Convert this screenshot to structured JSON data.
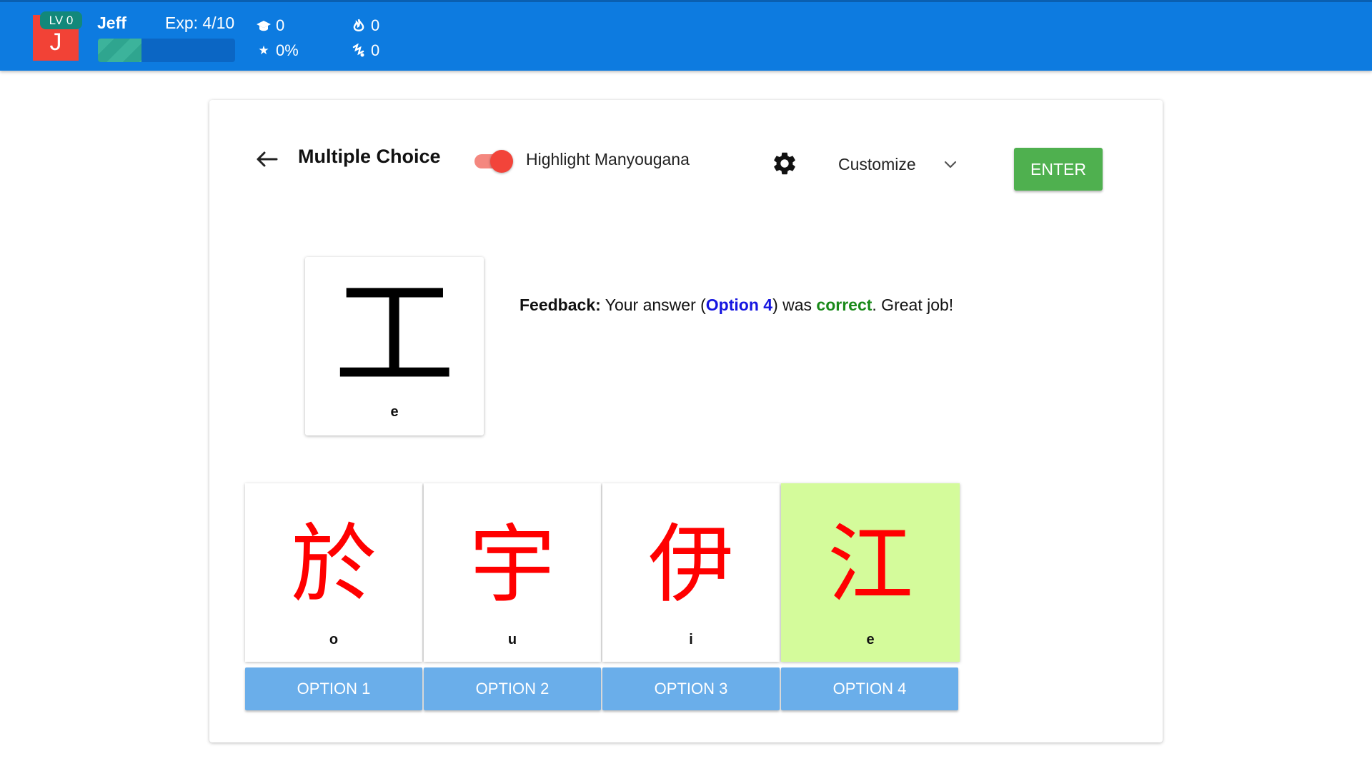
{
  "header": {
    "avatar_letter": "J",
    "level": "LV 0",
    "username": "Jeff",
    "exp": "Exp: 4/10",
    "exp_progress": 0.32,
    "stats": {
      "mastered": "0",
      "accuracy": "0%",
      "streak": "0",
      "combo": "0"
    }
  },
  "toolbar": {
    "title": "Multiple Choice",
    "toggle_label": "Highlight Manyougana",
    "toggle_on": true,
    "customize_label": "Customize",
    "enter_label": "ENTER"
  },
  "question": {
    "kanji": "工",
    "romaji": "e"
  },
  "feedback": {
    "label": "Feedback:",
    "text1": " Your answer (",
    "option": "Option 4",
    "text2": ") was ",
    "result": "correct",
    "text3": ". Great job!"
  },
  "options": [
    {
      "kanji_red": "於",
      "romaji": "o",
      "button": "OPTION 1"
    },
    {
      "kanji_red": "宇",
      "romaji": "u",
      "button": "OPTION 2"
    },
    {
      "kanji_red": "伊",
      "romaji": "i",
      "button": "OPTION 3"
    },
    {
      "kanji_red": "江",
      "romaji": "e",
      "button": "OPTION 4",
      "selected": true
    }
  ],
  "colors": {
    "header_bg": "#0d7be0",
    "highlight_red": "#ff0000",
    "selected_bg": "#d4fb9b",
    "option_button": "#6aaeea",
    "enter_button": "#4fb04f"
  }
}
